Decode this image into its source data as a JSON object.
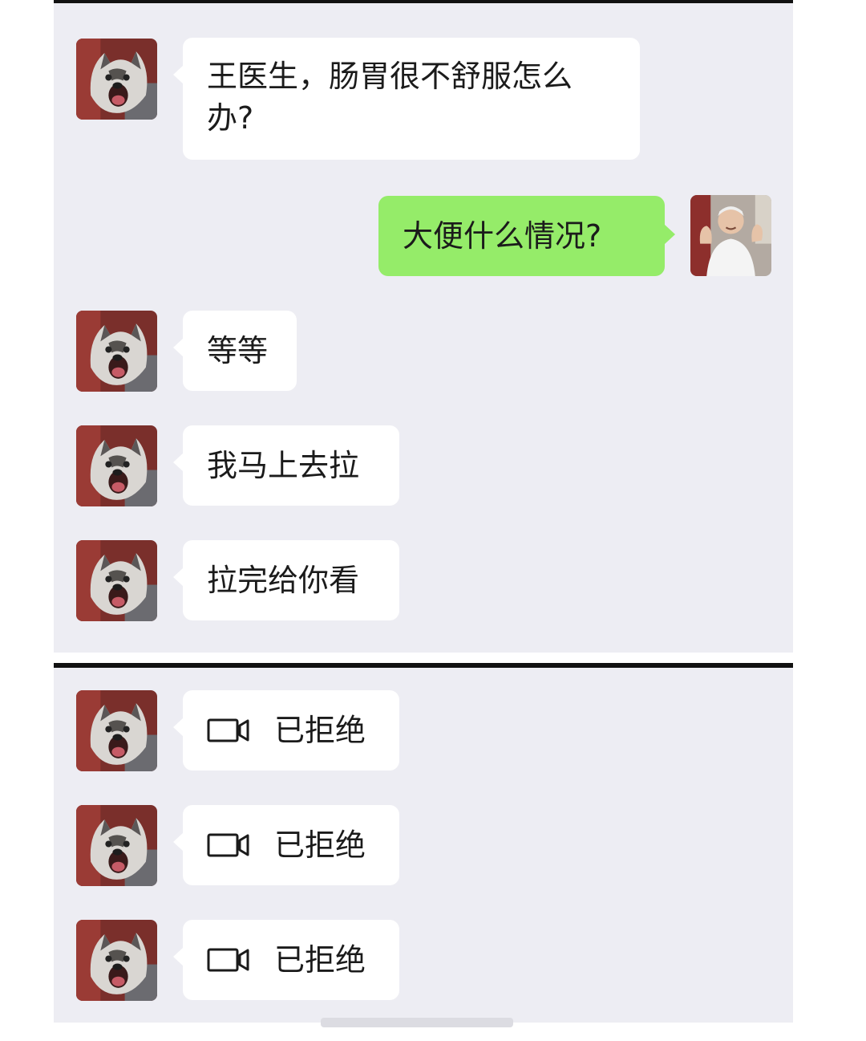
{
  "messages": [
    {
      "side": "left",
      "avatar": "husky-avatar",
      "text": "王医生，肠胃很不舒服怎么办?"
    },
    {
      "side": "right",
      "avatar": "doctor-avatar",
      "text": "大便什么情况?"
    },
    {
      "side": "left",
      "avatar": "husky-avatar",
      "text": "等等"
    },
    {
      "side": "left",
      "avatar": "husky-avatar",
      "text": "我马上去拉"
    },
    {
      "side": "left",
      "avatar": "husky-avatar",
      "text": "拉完给你看"
    }
  ],
  "calls": [
    {
      "side": "left",
      "avatar": "husky-avatar",
      "icon": "video-camera-icon",
      "status": "已拒绝"
    },
    {
      "side": "left",
      "avatar": "husky-avatar",
      "icon": "video-camera-icon",
      "status": "已拒绝"
    },
    {
      "side": "left",
      "avatar": "husky-avatar",
      "icon": "video-camera-icon",
      "status": "已拒绝"
    }
  ],
  "colors": {
    "chat_background": "#ededf3",
    "incoming_bubble": "#ffffff",
    "outgoing_bubble": "#95ec69",
    "divider": "#111111"
  }
}
